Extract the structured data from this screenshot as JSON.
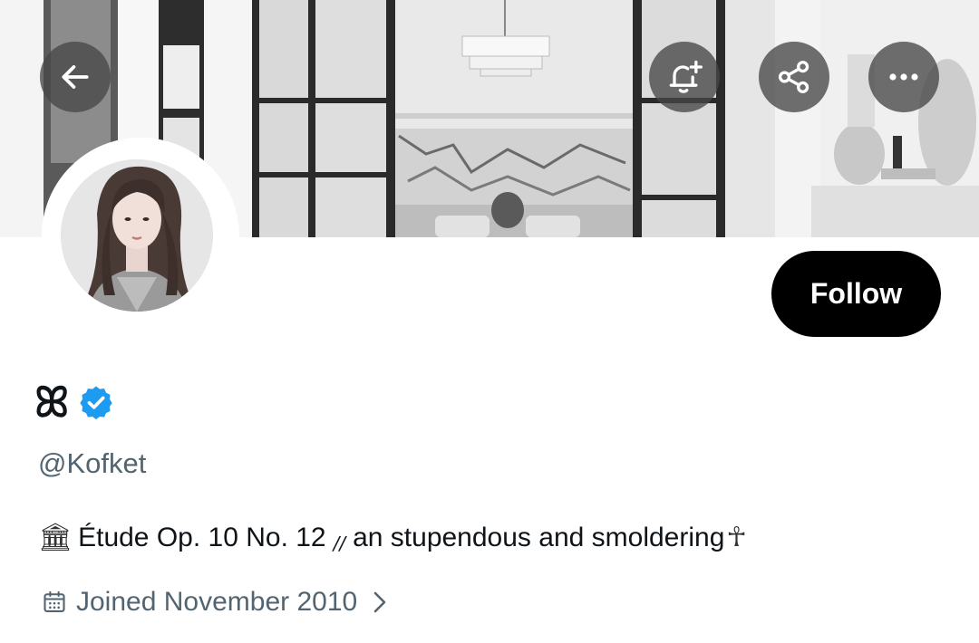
{
  "header": {
    "back_icon": "arrow-left-icon",
    "actions": [
      {
        "icon": "bell-plus-icon"
      },
      {
        "icon": "share-icon"
      },
      {
        "icon": "more-icon"
      }
    ]
  },
  "banner": {
    "tone": "grayscale"
  },
  "profile": {
    "display_name": "ꕤ",
    "verified": true,
    "verified_color": "#1d9bf0",
    "handle": "@Kofket",
    "bio": {
      "lead_icon": "🏛",
      "text_1": "Étude Op. 10 No. 12",
      "separator": "//",
      "text_2": "an stupendous and smoldering",
      "trail_icon": "☥"
    },
    "joined": "Joined November 2010"
  },
  "follow": {
    "label": "Follow"
  },
  "colors": {
    "button_bg": "#000000",
    "button_text": "#ffffff",
    "secondary_text": "#536471",
    "primary_text": "#0f1419"
  }
}
